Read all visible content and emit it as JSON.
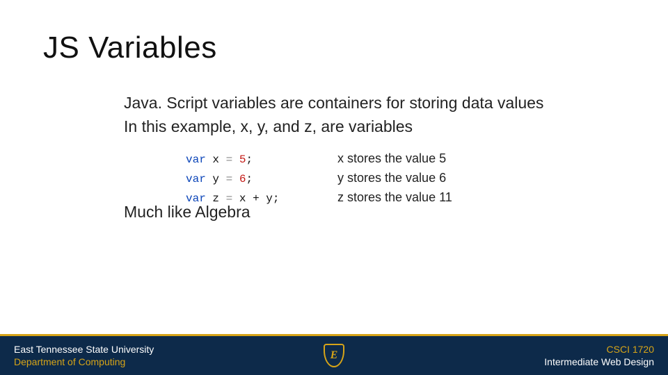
{
  "title": "JS Variables",
  "para1": "Java. Script variables are containers for storing data values",
  "para2": "In this example, x, y, and z, are variables",
  "para3": "Much like Algebra",
  "code": {
    "lines": [
      {
        "kw": "var",
        "name": "x",
        "eq": "=",
        "rhs_num": "5",
        "rhs_rest": ";",
        "explain": "x stores the value 5"
      },
      {
        "kw": "var",
        "name": "y",
        "eq": "=",
        "rhs_num": "6",
        "rhs_rest": ";",
        "explain": "y stores the value 6"
      },
      {
        "kw": "var",
        "name": "z",
        "eq": "=",
        "rhs_num": "",
        "rhs_rest": "x + y;",
        "explain": "z stores the value 11"
      }
    ]
  },
  "footer": {
    "left_line1": "East Tennessee State University",
    "left_line2": "Department of Computing",
    "right_line1": "CSCI 1720",
    "right_line2": "Intermediate Web Design",
    "logo_letter": "E"
  }
}
